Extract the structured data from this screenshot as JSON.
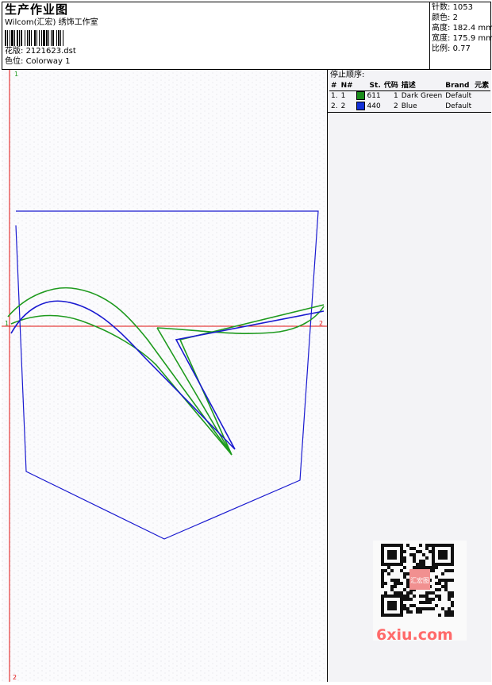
{
  "header": {
    "title": "生产作业图",
    "company": "Wilcom(汇宏) 绣饰工作室",
    "design_label": "花版:",
    "design_value": "2121623.dst",
    "colorway_label": "色位:",
    "colorway_value": "Colorway 1"
  },
  "stats": {
    "stitches_label": "针数:",
    "stitches_value": "1053",
    "colors_label": "颜色:",
    "colors_value": "2",
    "height_label": "高度:",
    "height_value": "182.4 mm",
    "width_label": "宽度:",
    "width_value": "175.9 mm",
    "scale_label": "比例:",
    "scale_value": "0.77"
  },
  "stop_sequence": {
    "title": "停止顺序:",
    "columns": [
      "#",
      "N#",
      "St.",
      "代码",
      "描述",
      "Brand",
      "元素"
    ],
    "rows": [
      {
        "index": "1.",
        "n": "1",
        "color": "#1a8c1a",
        "st": "611",
        "code": "1",
        "desc": "Dark Green",
        "brand": "Default"
      },
      {
        "index": "2.",
        "n": "2",
        "color": "#1230d8",
        "st": "440",
        "code": "2",
        "desc": "Blue",
        "brand": "Default"
      }
    ]
  },
  "canvas": {
    "start_marker_top": "1",
    "start_marker_left": "1",
    "end_marker_right": "2",
    "end_marker_bottom": "2",
    "colors": {
      "outline": "#1a1ad0",
      "green": "#1e9a1e",
      "guide": "#e01010"
    }
  },
  "watermark": {
    "site": "6xiu.com",
    "badge_text": "汇宏图"
  }
}
